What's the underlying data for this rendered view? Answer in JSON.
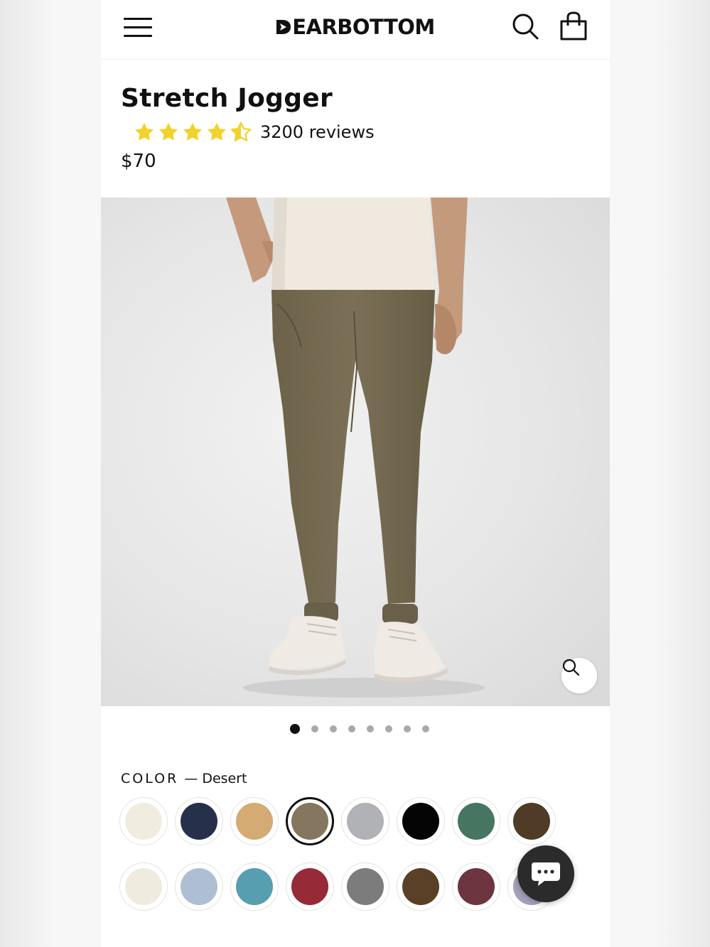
{
  "header": {
    "brand": "EARBOTTOM",
    "brand_full": "DEARBOTTOM"
  },
  "product": {
    "title": "Stretch Jogger",
    "rating": 4.5,
    "rating_max": 5,
    "reviews": "3200 reviews",
    "price": "$70"
  },
  "gallery": {
    "image_count": 8,
    "active_index": 0
  },
  "color": {
    "label": "COLOR",
    "selected": "— Desert",
    "swatches": [
      {
        "hex": "#f1ece0"
      },
      {
        "hex": "#26304a"
      },
      {
        "hex": "#d4ab73"
      },
      {
        "hex": "#857660",
        "selected": true
      },
      {
        "hex": "#b1b2b6"
      },
      {
        "hex": "#050505"
      },
      {
        "hex": "#467661"
      },
      {
        "hex": "#503b27"
      },
      {
        "hex": "#efebde"
      },
      {
        "hex": "#aebfd3"
      },
      {
        "hex": "#579eb1"
      },
      {
        "hex": "#962a37"
      },
      {
        "hex": "#7c7c7c"
      },
      {
        "hex": "#594027"
      },
      {
        "hex": "#6c3540"
      },
      {
        "hex": "#a3a1bb"
      }
    ]
  },
  "colors": {
    "star": "#f2d22b",
    "accent": "#111111"
  },
  "icons": {
    "menu": "hamburger-icon",
    "search": "search-icon",
    "cart": "shopping-bag-icon",
    "zoom": "zoom-icon",
    "chat": "chat-icon"
  }
}
